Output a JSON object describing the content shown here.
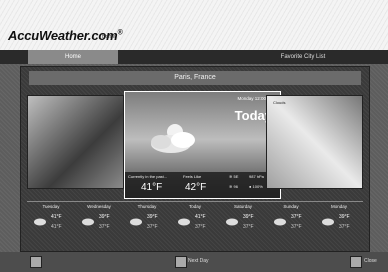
{
  "header": {
    "logo_text": "AccuWeather.com",
    "logo_reg": "®",
    "home_small": "Home"
  },
  "tabs": [
    {
      "label": "Home"
    },
    {
      "label": "Favorite City List"
    }
  ],
  "city": {
    "name": "Paris, France"
  },
  "current": {
    "datetime": "Monday 12:00 PM",
    "day_label": "Today",
    "currently_label": "Currently in the past...",
    "temp": "41°F",
    "feels_label": "Feels Like",
    "feels_temp": "42°F",
    "wind": "≋ 5E",
    "humidity": "≋ 96",
    "pressure": "987 hPa",
    "precip": "● 100%"
  },
  "right_image_label": "Clouds",
  "forecast": [
    {
      "day": "Tuesday",
      "hi": "41°F",
      "lo": "41°F"
    },
    {
      "day": "Wednesday",
      "hi": "39°F",
      "lo": "37°F"
    },
    {
      "day": "Thursday",
      "hi": "39°F",
      "lo": "37°F"
    },
    {
      "day": "Today",
      "hi": "41°F",
      "lo": "37°F"
    },
    {
      "day": "Saturday",
      "hi": "39°F",
      "lo": "37°F"
    },
    {
      "day": "Sunday",
      "hi": "37°F",
      "lo": "37°F"
    },
    {
      "day": "Monday",
      "hi": "39°F",
      "lo": "37°F"
    }
  ],
  "bottom": {
    "mid_label": "Next Day",
    "right_label": "Close"
  }
}
